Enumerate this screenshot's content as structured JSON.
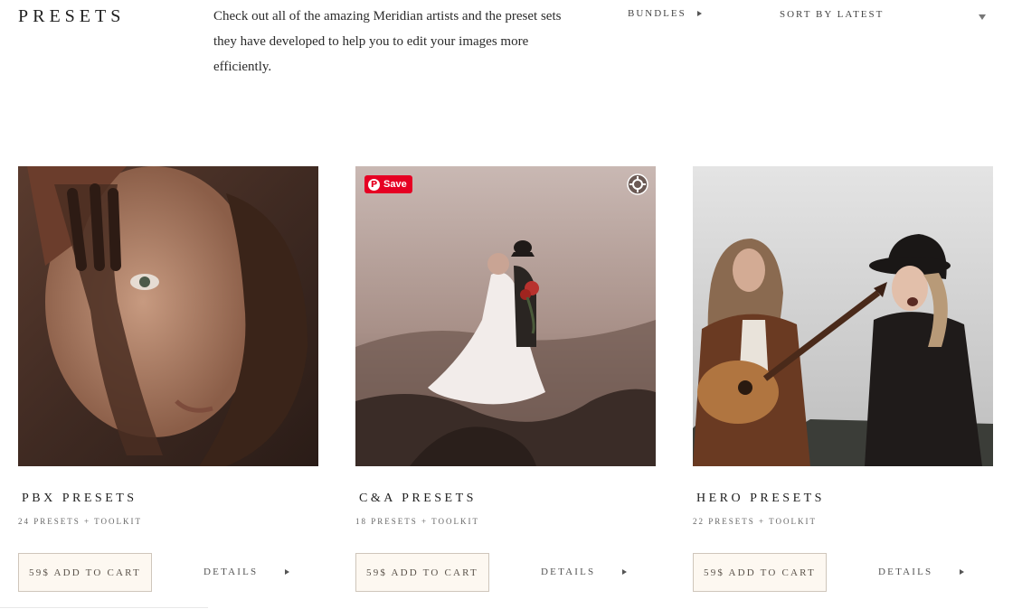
{
  "header": {
    "title": "PRESETS",
    "description": "Check out all of the amazing Meridian artists and the preset sets they have developed to help you to edit your images more efficiently."
  },
  "filters": {
    "bundles_label": "BUNDLES",
    "sort_selected": "SORT BY LATEST"
  },
  "products": [
    {
      "title": "PBX PRESETS",
      "subtitle": "24 PRESETS + TOOLKIT",
      "add_to_cart": "59$ ADD TO CART",
      "details": "DETAILS",
      "image_icon": "couple-portrait-photo"
    },
    {
      "title": "C&A PRESETS",
      "subtitle": "18 PRESETS + TOOLKIT",
      "add_to_cart": "59$ ADD TO CART",
      "details": "DETAILS",
      "image_icon": "wedding-couple-photo",
      "pinterest_save": "Save"
    },
    {
      "title": "HERO PRESETS",
      "subtitle": "22 PRESETS + TOOLKIT",
      "add_to_cart": "59$ ADD TO CART",
      "details": "DETAILS",
      "image_icon": "musicians-photo"
    }
  ],
  "colors": {
    "text": "#1e1e1e",
    "button_bg": "#fdf8f1",
    "button_border": "#cfc6bb",
    "pinterest": "#e60023"
  }
}
